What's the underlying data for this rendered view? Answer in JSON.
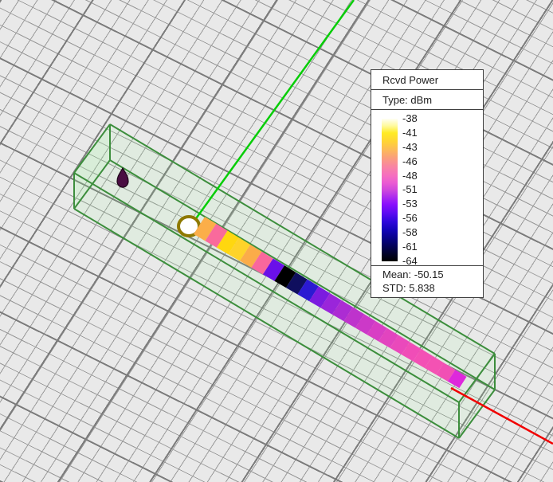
{
  "legend": {
    "title": "Rcvd Power",
    "type_label": "Type: dBm",
    "tick_labels": [
      "-38",
      "-41",
      "-43",
      "-46",
      "-48",
      "-51",
      "-53",
      "-56",
      "-58",
      "-61",
      "-64"
    ],
    "stats": {
      "mean_label": "Mean: -50.15",
      "std_label": "STD: 5.838"
    },
    "colorbar_stops": [
      [
        "0%",
        "#FFFFF4"
      ],
      [
        "5%",
        "#FFFA9E"
      ],
      [
        "10%",
        "#FFEB25"
      ],
      [
        "16%",
        "#FFD435"
      ],
      [
        "22%",
        "#FCB95A"
      ],
      [
        "28%",
        "#FA9C80"
      ],
      [
        "34%",
        "#F883A5"
      ],
      [
        "40%",
        "#F56EC0"
      ],
      [
        "45%",
        "#EA5BD2"
      ],
      [
        "50%",
        "#CF48DC"
      ],
      [
        "55%",
        "#AC2BEE"
      ],
      [
        "60%",
        "#8A0FFC"
      ],
      [
        "66%",
        "#5E0BF2"
      ],
      [
        "72%",
        "#2F07DC"
      ],
      [
        "78%",
        "#1203B8"
      ],
      [
        "84%",
        "#070287"
      ],
      [
        "90%",
        "#030253"
      ],
      [
        "95%",
        "#010227"
      ],
      [
        "100%",
        "#000000"
      ]
    ]
  },
  "scene": {
    "colors": {
      "background": "#E9E9E9",
      "grid_minor": "#9A9A9A",
      "grid_major": "#7C7C7C",
      "axis_green": "#07CD07",
      "axis_red": "#F10000",
      "box_edge": "#3C8E3C",
      "box_face": "rgba(150,255,150,0.10)",
      "tx_marker_fill": "#4A0E42",
      "tx_marker_stroke": "#1D0618",
      "start_marker_fill": "#FFFFFF",
      "start_marker_ring": "#8E7900"
    },
    "trail": {
      "start": [
        250,
        283
      ],
      "end": [
        581,
        480
      ],
      "half_width_start": 13,
      "half_width_end": 8.5,
      "steep_dir": [
        -0.542,
        0.841
      ],
      "colors": [
        "#FBAE49",
        "#F96A9C",
        "#FFD70F",
        "#FED32A",
        "#FBAC49",
        "#F9679D",
        "#6A10E8",
        "#000000",
        "#0F0F5E",
        "#2B1AD2",
        "#7B1BDF",
        "#9A25DA",
        "#AC2CD3",
        "#BE33CC",
        "#CC39C8",
        "#D83EC4",
        "#E244BF",
        "#EA49BB",
        "#F04DB7",
        "#F350B5",
        "#F452B3",
        "#F150B4",
        "#DE28DC"
      ]
    }
  },
  "chart_data": {
    "type": "heatmap",
    "title": "Rcvd Power",
    "units": "dBm",
    "colorbar_ticks": [
      -38,
      -41,
      -43,
      -46,
      -48,
      -51,
      -53,
      -56,
      -58,
      -61,
      -64
    ],
    "colorbar_range": [
      -64,
      -38
    ],
    "mean": -50.15,
    "std": 5.838,
    "legend_position": "right",
    "trail_segments_approx_dbm": [
      -44,
      -47.5,
      -41,
      -41.5,
      -44,
      -47.5,
      -56.5,
      -63.5,
      -60.5,
      -57.5,
      -55.5,
      -54,
      -53,
      -52.5,
      -52,
      -51.5,
      -51,
      -50.5,
      -50,
      -50,
      -50,
      -50.2,
      -52.5
    ]
  }
}
